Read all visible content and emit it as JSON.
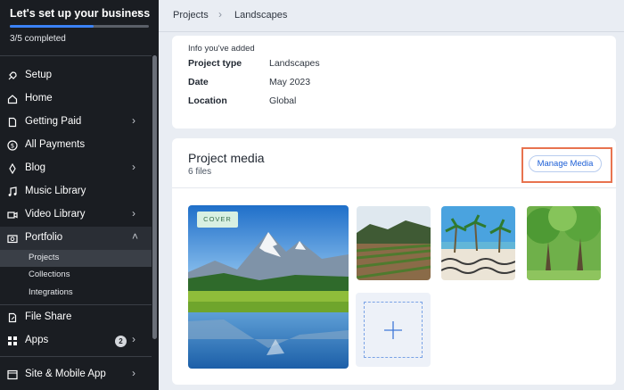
{
  "setup": {
    "title": "Let's set up your business",
    "progress_text": "3/5 completed",
    "progress_fraction": 0.6
  },
  "sidebar": {
    "items": [
      {
        "label": "Setup",
        "icon": "rocket-icon"
      },
      {
        "label": "Home",
        "icon": "home-icon"
      },
      {
        "label": "Getting Paid",
        "icon": "document-icon"
      },
      {
        "label": "All Payments",
        "icon": "dollar-icon"
      },
      {
        "label": "Blog",
        "icon": "pen-icon"
      },
      {
        "label": "Music Library",
        "icon": "music-icon"
      },
      {
        "label": "Video Library",
        "icon": "video-icon"
      },
      {
        "label": "Portfolio",
        "icon": "portfolio-icon"
      },
      {
        "label": "File Share",
        "icon": "file-share-icon"
      },
      {
        "label": "Apps",
        "icon": "apps-icon",
        "badge": "2"
      },
      {
        "label": "Site & Mobile App",
        "icon": "site-icon"
      }
    ],
    "portfolio_sub": [
      "Projects",
      "Collections",
      "Integrations"
    ]
  },
  "breadcrumb": [
    "Projects",
    "Landscapes"
  ],
  "info": {
    "hint": "Info you've added",
    "rows": [
      {
        "key": "Project type",
        "value": "Landscapes"
      },
      {
        "key": "Date",
        "value": "May 2023"
      },
      {
        "key": "Location",
        "value": "Global"
      }
    ]
  },
  "media": {
    "title": "Project media",
    "count": "6 files",
    "manage_label": "Manage Media",
    "cover_label": "COVER",
    "highlight_color": "#e8734f"
  }
}
